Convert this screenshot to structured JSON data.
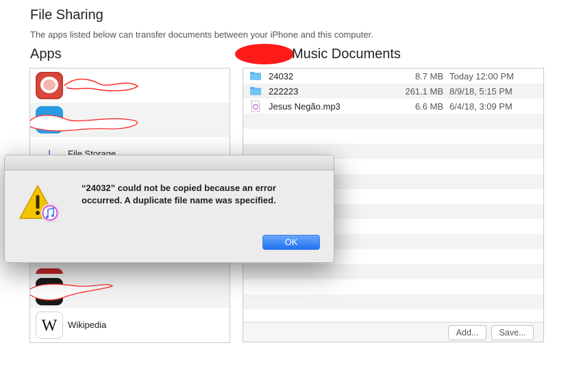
{
  "header": {
    "title": "File Sharing",
    "subtitle": "The apps listed below can transfer documents between your iPhone and this computer."
  },
  "apps_panel": {
    "heading": "Apps",
    "items": [
      {
        "name": "",
        "icon": "redacted-app-icon",
        "color": "#d9473c"
      },
      {
        "name": "",
        "icon": "redacted-app-icon",
        "color": "#2a9be0"
      },
      {
        "name": "File Storage",
        "icon": "download-arrow-icon"
      },
      {
        "name": "",
        "icon": "hidden-app-icon"
      },
      {
        "name": "",
        "icon": "hidden-app-icon"
      },
      {
        "name": "",
        "icon": "hidden-app-icon"
      },
      {
        "name": "",
        "icon": "redacted-app-icon",
        "color": "#c62828"
      },
      {
        "name": "",
        "icon": "redacted-app-icon",
        "color": "#1a1a1a"
      },
      {
        "name": "Wikipedia",
        "icon": "wikipedia-w-icon"
      }
    ]
  },
  "docs_panel": {
    "heading_suffix": "Music Documents",
    "files": [
      {
        "name": "24032",
        "size": "8.7 MB",
        "date": "Today 12:00 PM",
        "icon": "folder-icon"
      },
      {
        "name": "222223",
        "size": "261.1 MB",
        "date": "8/9/18, 5:15 PM",
        "icon": "folder-icon"
      },
      {
        "name": "Jesus Negão.mp3",
        "size": "6.6 MB",
        "date": "6/4/18, 3:09 PM",
        "icon": "mp3-file-icon"
      }
    ],
    "add_label": "Add...",
    "save_label": "Save..."
  },
  "alert": {
    "message": "“24032” could not be copied because an error occurred. A duplicate file name was specified.",
    "ok_label": "OK",
    "icon": "warning-itunes-icon"
  },
  "colors": {
    "accent": "#1f72f2",
    "folder": "#5ab3f0",
    "warning": "#f5c400",
    "redaction": "#ff1a1a"
  }
}
